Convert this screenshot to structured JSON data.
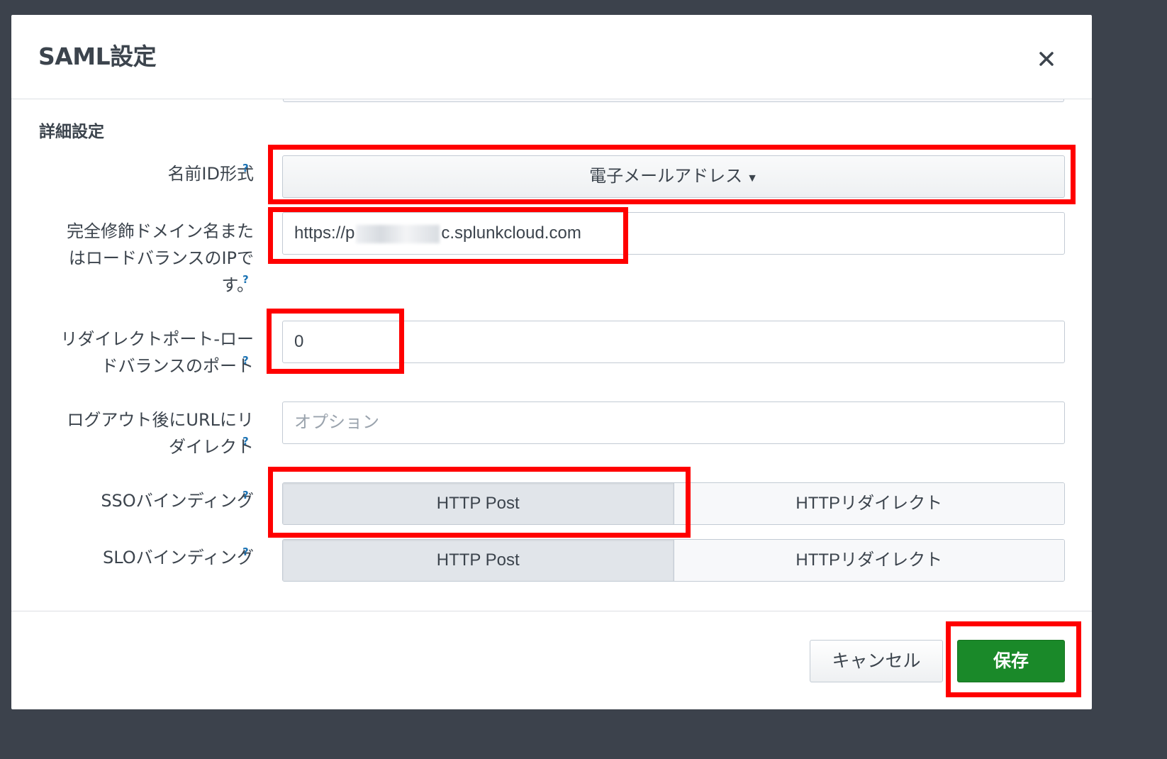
{
  "dialog": {
    "title": "SAML設定",
    "close_symbol": "close-icon"
  },
  "section": {
    "heading": "詳細設定"
  },
  "fields": {
    "name_id_format": {
      "label": "名前ID形式",
      "help": "?",
      "value": "電子メールアドレス",
      "caret_icon": "caret-down-icon"
    },
    "fqdn": {
      "label_lines": [
        "完全修飾ドメイン名また",
        "はロードバランスのIPで",
        "す。"
      ],
      "help": "?",
      "value_prefix": "https://p",
      "value_suffix": "c.splunkcloud.com"
    },
    "redirect_port": {
      "label_lines": [
        "リダイレクトポート-ロー",
        "ドバランスのポート"
      ],
      "help": "?",
      "value": "0"
    },
    "logout_redirect": {
      "label_lines": [
        "ログアウト後にURLにリ",
        "ダイレクト"
      ],
      "help": "?",
      "placeholder": "オプション"
    },
    "sso_binding": {
      "label": "SSOバインディング",
      "help": "?",
      "options": [
        "HTTP Post",
        "HTTPリダイレクト"
      ],
      "selected": "HTTP Post"
    },
    "slo_binding": {
      "label": "SLOバインディング",
      "help": "?",
      "options": [
        "HTTP Post",
        "HTTPリダイレクト"
      ],
      "selected": "HTTP Post"
    }
  },
  "footer": {
    "cancel_label": "キャンセル",
    "save_label": "保存"
  },
  "colors": {
    "overlay": "#3c424c",
    "save_button": "#1a8929",
    "highlight": "#ff0000",
    "help_link": "#1d74b5"
  }
}
